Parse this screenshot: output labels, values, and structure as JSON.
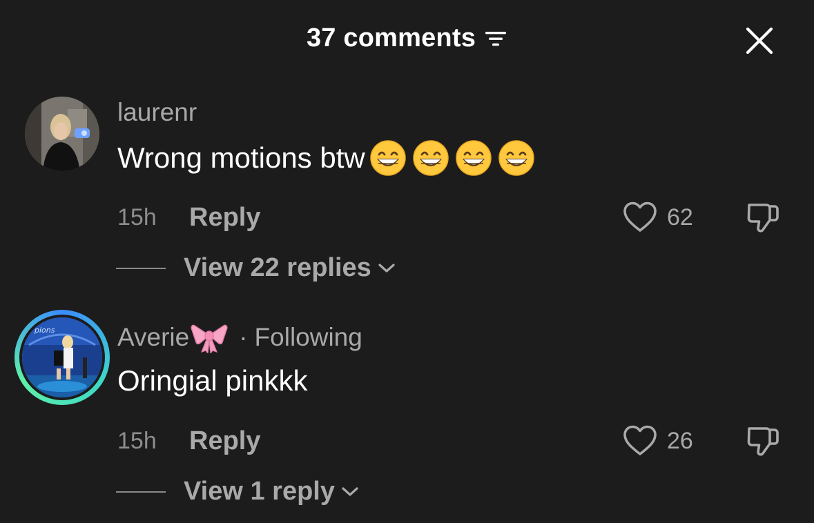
{
  "header": {
    "title": "37 comments",
    "filter_icon": "filter-lines-icon",
    "close_icon": "close-x-icon"
  },
  "comments": [
    {
      "username": "laurenr",
      "text": "Wrong motions btw",
      "emojis": [
        "grinning-face",
        "grinning-face",
        "grinning-face",
        "grinning-face"
      ],
      "time": "15h",
      "reply_label": "Reply",
      "likes": "62",
      "view_replies": "View 22 replies"
    },
    {
      "username": "Averie",
      "username_emoji": "pink-bow",
      "following": "Following",
      "separator": "·",
      "text": "Oringial pinkkk",
      "time": "15h",
      "reply_label": "Reply",
      "likes": "26",
      "view_replies": "View 1 reply"
    }
  ],
  "colors": {
    "background": "#1c1c1c",
    "text_primary": "#ffffff",
    "text_secondary": "#a9a9a9"
  }
}
